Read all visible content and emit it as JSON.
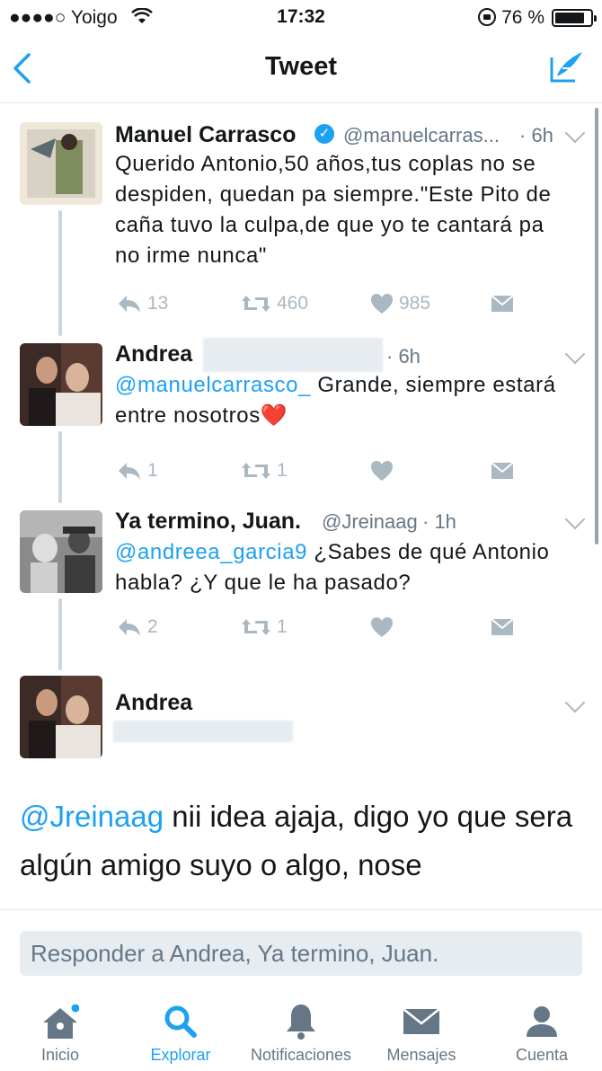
{
  "status_bar": {
    "carrier": "●●●●○ Yoigo",
    "time": "17:32",
    "battery": "76 %"
  },
  "nav": {
    "title": "Tweet"
  },
  "tweets": [
    {
      "name": "Manuel Carrasco",
      "handle": "@manuelcarras...",
      "time": "· 6h",
      "text_parts": [
        "Querido Antonio,50 años,tus coplas no se despiden, quedan pa siempre.\"Este Pito de caña tuvo la culpa,de que yo te cantará pa no irme nunca\""
      ],
      "replies": "13",
      "retweets": "460",
      "likes": "985"
    },
    {
      "name": "Andrea",
      "time": "· 6h",
      "mention": "@manuelcarrasco_",
      "text": " Grande, siempre estará entre nosotros❤️",
      "replies": "1",
      "retweets": "1",
      "likes": ""
    },
    {
      "name": "Ya termino, Juan.",
      "handle": "@Jreinaag",
      "time": "· 1h",
      "mention": "@andreea_garcia9",
      "text": " ¿Sabes de qué Antonio habla? ¿Y que le ha pasado?",
      "replies": "2",
      "retweets": "1",
      "likes": ""
    }
  ],
  "main_tweet": {
    "name": "Andrea",
    "mention": "@Jreinaag",
    "text": " nii idea ajaja, digo yo que sera algún amigo suyo o algo, nose"
  },
  "reply": {
    "placeholder": "Responder a Andrea, Ya termino, Juan."
  },
  "tabs": [
    {
      "label": "Inicio",
      "icon": "home-icon"
    },
    {
      "label": "Explorar",
      "icon": "search-icon"
    },
    {
      "label": "Notificaciones",
      "icon": "bell-icon"
    },
    {
      "label": "Mensajes",
      "icon": "envelope-icon"
    },
    {
      "label": "Cuenta",
      "icon": "person-icon"
    }
  ],
  "colors": {
    "accent": "#1da1f2",
    "muted": "#aab8c2",
    "text": "#14171a"
  }
}
